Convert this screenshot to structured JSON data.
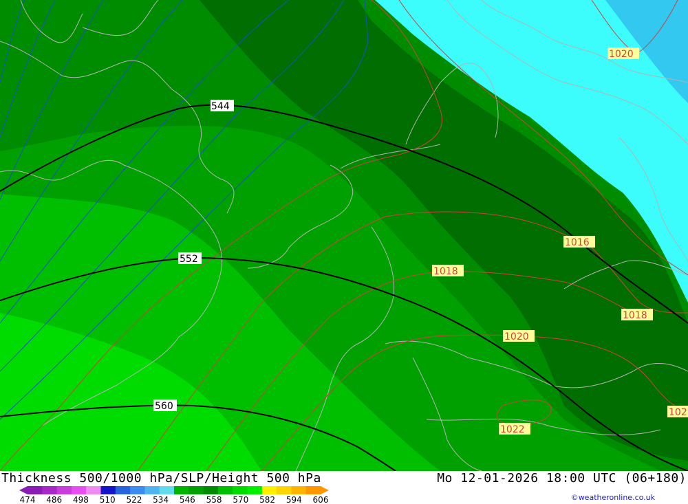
{
  "title": "Thickness 500/1000 hPa/SLP/Height 500 hPa",
  "datetime": "Mo 12-01-2026 18:00 UTC (06+180)",
  "credit": "©weatheronline.co.uk",
  "legend": {
    "ticks": [
      "474",
      "486",
      "498",
      "510",
      "522",
      "534",
      "546",
      "558",
      "570",
      "582",
      "594",
      "606"
    ],
    "colors": [
      "#8a1cb4",
      "#a628c8",
      "#c83cdc",
      "#e650f0",
      "#f08cf0",
      "#1414c8",
      "#2864dc",
      "#3c8cf0",
      "#50b4f0",
      "#64dcf0",
      "#00b400",
      "#00a000",
      "#008c00",
      "#00be00",
      "#00dc00",
      "#00f000",
      "#fff000",
      "#ffd400",
      "#ffb400",
      "#ff9600"
    ]
  },
  "map": {
    "height_500_labels": [
      "544",
      "552",
      "560"
    ],
    "slp_labels": [
      "1020",
      "1016",
      "1018",
      "1018",
      "1020",
      "1022",
      "102"
    ],
    "colors": {
      "thickness_bands": [
        "#00dc00",
        "#00be00",
        "#00a000",
        "#008c00",
        "#006e00",
        "#3cfcfc",
        "#32c8f0"
      ],
      "height_contour": "#000000",
      "slp_contour": "#d04040",
      "thickness_contour": "#1a50c8",
      "coastline": "#b4b4b4",
      "label_bg": "#ffff99"
    }
  }
}
